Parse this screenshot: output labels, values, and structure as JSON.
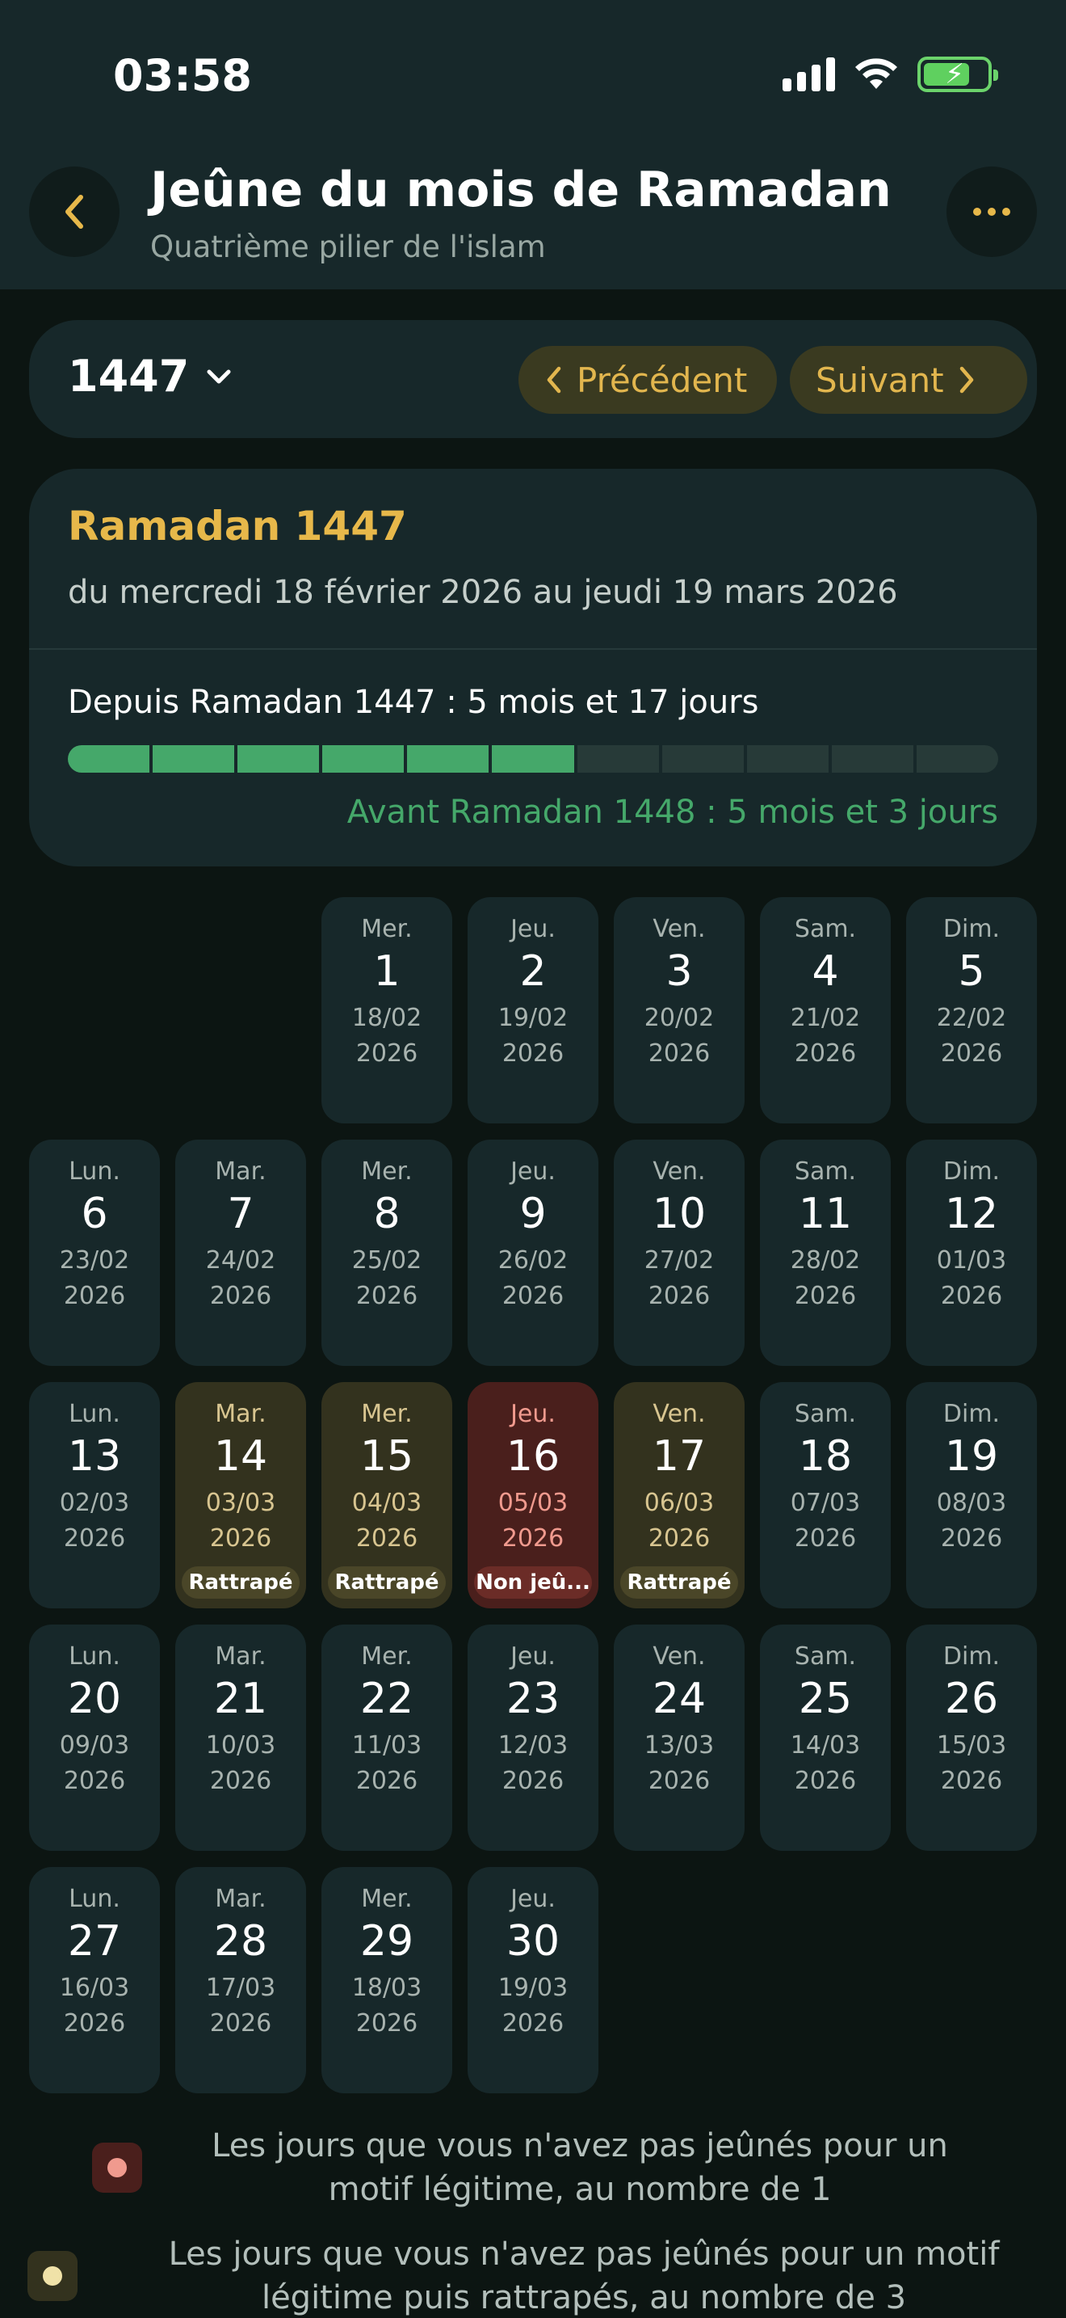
{
  "status": {
    "time": "03:58"
  },
  "header": {
    "title": "Jeûne du mois de Ramadan",
    "subtitle": "Quatrième pilier de l'islam"
  },
  "year_bar": {
    "year": "1447",
    "prev_label": "Précédent",
    "next_label": "Suivant"
  },
  "info_card": {
    "title": "Ramadan 1447",
    "range": "du mercredi 18 février 2026 au jeudi 19 mars 2026",
    "since": "Depuis Ramadan 1447 : 5 mois et 17 jours",
    "before": "Avant Ramadan 1448 : 5 mois et 3 jours",
    "progress_segments_total": 11,
    "progress_segments_filled": 6
  },
  "days": [
    {
      "wd": "Mer.",
      "num": "1",
      "date": "18/02",
      "year": "2026",
      "col": 2,
      "row": 0
    },
    {
      "wd": "Jeu.",
      "num": "2",
      "date": "19/02",
      "year": "2026",
      "col": 3,
      "row": 0
    },
    {
      "wd": "Ven.",
      "num": "3",
      "date": "20/02",
      "year": "2026",
      "col": 4,
      "row": 0
    },
    {
      "wd": "Sam.",
      "num": "4",
      "date": "21/02",
      "year": "2026",
      "col": 5,
      "row": 0
    },
    {
      "wd": "Dim.",
      "num": "5",
      "date": "22/02",
      "year": "2026",
      "col": 6,
      "row": 0
    },
    {
      "wd": "Lun.",
      "num": "6",
      "date": "23/02",
      "year": "2026",
      "col": 0,
      "row": 1
    },
    {
      "wd": "Mar.",
      "num": "7",
      "date": "24/02",
      "year": "2026",
      "col": 1,
      "row": 1
    },
    {
      "wd": "Mer.",
      "num": "8",
      "date": "25/02",
      "year": "2026",
      "col": 2,
      "row": 1
    },
    {
      "wd": "Jeu.",
      "num": "9",
      "date": "26/02",
      "year": "2026",
      "col": 3,
      "row": 1
    },
    {
      "wd": "Ven.",
      "num": "10",
      "date": "27/02",
      "year": "2026",
      "col": 4,
      "row": 1
    },
    {
      "wd": "Sam.",
      "num": "11",
      "date": "28/02",
      "year": "2026",
      "col": 5,
      "row": 1
    },
    {
      "wd": "Dim.",
      "num": "12",
      "date": "01/03",
      "year": "2026",
      "col": 6,
      "row": 1
    },
    {
      "wd": "Lun.",
      "num": "13",
      "date": "02/03",
      "year": "2026",
      "col": 0,
      "row": 2
    },
    {
      "wd": "Mar.",
      "num": "14",
      "date": "03/03",
      "year": "2026",
      "col": 1,
      "row": 2,
      "status": "made",
      "badge": "Rattrapé"
    },
    {
      "wd": "Mer.",
      "num": "15",
      "date": "04/03",
      "year": "2026",
      "col": 2,
      "row": 2,
      "status": "made",
      "badge": "Rattrapé"
    },
    {
      "wd": "Jeu.",
      "num": "16",
      "date": "05/03",
      "year": "2026",
      "col": 3,
      "row": 2,
      "status": "missed",
      "badge": "Non jeû..."
    },
    {
      "wd": "Ven.",
      "num": "17",
      "date": "06/03",
      "year": "2026",
      "col": 4,
      "row": 2,
      "status": "made",
      "badge": "Rattrapé"
    },
    {
      "wd": "Sam.",
      "num": "18",
      "date": "07/03",
      "year": "2026",
      "col": 5,
      "row": 2
    },
    {
      "wd": "Dim.",
      "num": "19",
      "date": "08/03",
      "year": "2026",
      "col": 6,
      "row": 2
    },
    {
      "wd": "Lun.",
      "num": "20",
      "date": "09/03",
      "year": "2026",
      "col": 0,
      "row": 3
    },
    {
      "wd": "Mar.",
      "num": "21",
      "date": "10/03",
      "year": "2026",
      "col": 1,
      "row": 3
    },
    {
      "wd": "Mer.",
      "num": "22",
      "date": "11/03",
      "year": "2026",
      "col": 2,
      "row": 3
    },
    {
      "wd": "Jeu.",
      "num": "23",
      "date": "12/03",
      "year": "2026",
      "col": 3,
      "row": 3
    },
    {
      "wd": "Ven.",
      "num": "24",
      "date": "13/03",
      "year": "2026",
      "col": 4,
      "row": 3
    },
    {
      "wd": "Sam.",
      "num": "25",
      "date": "14/03",
      "year": "2026",
      "col": 5,
      "row": 3
    },
    {
      "wd": "Dim.",
      "num": "26",
      "date": "15/03",
      "year": "2026",
      "col": 6,
      "row": 3
    },
    {
      "wd": "Lun.",
      "num": "27",
      "date": "16/03",
      "year": "2026",
      "col": 0,
      "row": 4
    },
    {
      "wd": "Mar.",
      "num": "28",
      "date": "17/03",
      "year": "2026",
      "col": 1,
      "row": 4
    },
    {
      "wd": "Mer.",
      "num": "29",
      "date": "18/03",
      "year": "2026",
      "col": 2,
      "row": 4
    },
    {
      "wd": "Jeu.",
      "num": "30",
      "date": "19/03",
      "year": "2026",
      "col": 3,
      "row": 4
    }
  ],
  "legend": {
    "missed_text": "Les jours que vous n'avez pas jeûnés pour un motif légitime, au nombre de 1",
    "made_text": "Les jours que vous n'avez pas jeûnés pour un motif légitime puis rattrapés, au nombre de 3",
    "missed_color": "#f09a8e",
    "made_color": "#f0e2a8"
  },
  "icons": {
    "back": "chevron-left-icon",
    "more": "ellipsis-icon",
    "year_dropdown": "chevron-down-icon",
    "prev": "chevron-left-icon",
    "next": "chevron-right-icon"
  }
}
